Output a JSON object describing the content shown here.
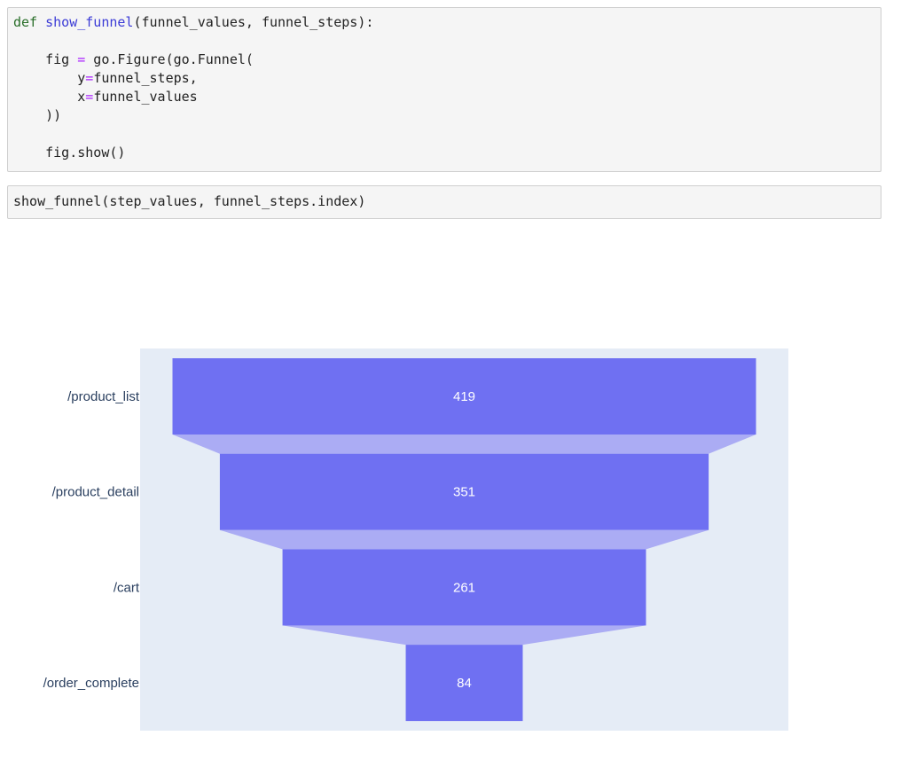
{
  "cells": [
    {
      "lines": [
        [
          {
            "t": "def",
            "c": "kw"
          },
          {
            "t": " "
          },
          {
            "t": "show_funnel",
            "c": "fn"
          },
          {
            "t": "(funnel_values, funnel_steps):"
          }
        ],
        [],
        [
          {
            "t": "    fig "
          },
          {
            "t": "=",
            "c": "op"
          },
          {
            "t": " go.Figure(go.Funnel("
          }
        ],
        [
          {
            "t": "        y"
          },
          {
            "t": "=",
            "c": "op"
          },
          {
            "t": "funnel_steps,"
          }
        ],
        [
          {
            "t": "        x"
          },
          {
            "t": "=",
            "c": "op"
          },
          {
            "t": "funnel_values"
          }
        ],
        [
          {
            "t": "    ))"
          }
        ],
        [],
        [
          {
            "t": "    fig.show()"
          }
        ]
      ]
    },
    {
      "lines": [
        [
          {
            "t": "show_funnel(step_values, funnel_steps.index)"
          }
        ]
      ]
    }
  ],
  "colors": {
    "plot_background": "#e5ecf6",
    "bar": "#6f70f2",
    "connector": "#abacf4",
    "bar_text": "#ffffff",
    "tick_text": "#2a3f5f",
    "code_keyword": "#2a6f2a",
    "code_function": "#3b3bd6",
    "code_operator": "#aa22ff"
  },
  "chart_data": {
    "type": "funnel",
    "categories": [
      "/product_list",
      "/product_detail",
      "/cart",
      "/order_complete"
    ],
    "values": [
      419,
      351,
      261,
      84
    ],
    "title": "",
    "xlabel": "",
    "ylabel": "",
    "grid": false,
    "legend": "none"
  }
}
